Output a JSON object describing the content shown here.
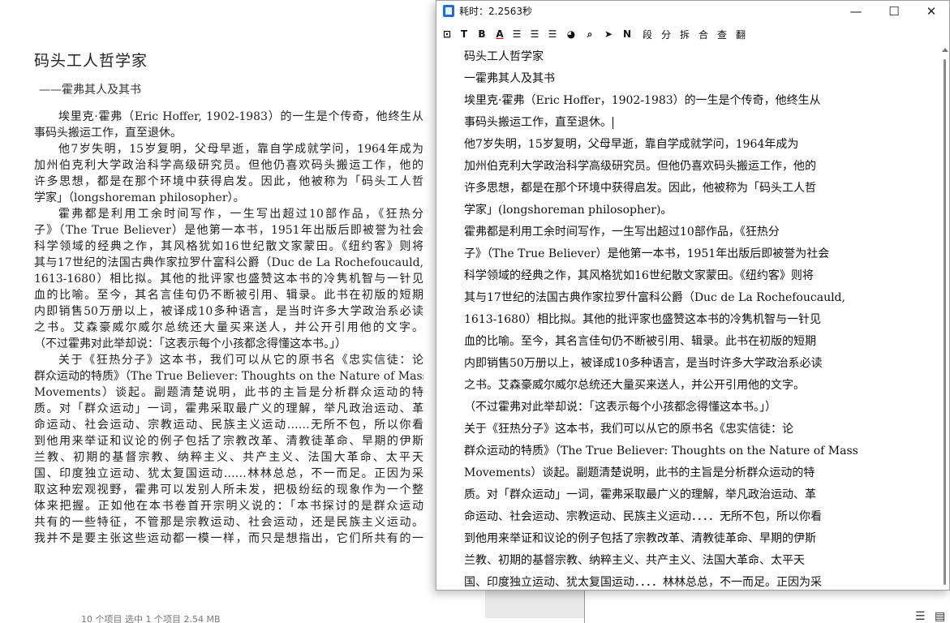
{
  "document": {
    "title": "码头工人哲学家",
    "subtitle": "——霍弗其人及其书",
    "lines": [
      "埃里克·霍弗（Eric Hoffer, 1902-1983）的一生是个传奇，他终生从",
      "事码头搬运工作，直至退休。",
      "他7岁失明，15岁复明，父母早逝，靠自学成就学问，1964年成为",
      "加州伯克利大学政治科学高级研究员。但他仍喜欢码头搬运工作，他的",
      "许多思想，都是在那个环境中获得启发。因此，他被称为「码头工人哲",
      "学家」（longshoreman philosopher）。",
      "霍弗都是利用工余时间写作，一生写出超过10部作品，《狂热分",
      "子》（The True Believer）是他第一本书，1951年出版后即被誉为社会",
      "科学领域的经典之作，其风格犹如16世纪散文家蒙田。《纽约客》则将",
      "其与17世纪的法国古典作家拉罗什富科公爵（Duc de La Rochefoucauld,",
      "1613-1680）相比拟。其他的批评家也盛赞这本书的冷隽机智与一针见",
      "血的比喻。至今，其名言佳句仍不断被引用、辑录。此书在初版的短期",
      "内即销售50万册以上，被译成10多种语言，是当时许多大学政治系必读",
      "之书。艾森豪威尔威尔总统还大量买来送人，并公开引用他的文字。",
      "（不过霍弗对此举却说：「这表示每个小孩都念得懂这本书。」）",
      "关于《狂热分子》这本书，我们可以从它的原书名《忠实信徒：论",
      "群众运动的特质》（The True Believer: Thoughts on the Nature of Mass",
      "Movements）谈起。副题清楚说明，此书的主旨是分析群众运动的特",
      "质。对「群众运动」一词，霍弗采取最广义的理解，举凡政治运动、革",
      "命运动、社会运动、宗教运动、民族主义运动……无所不包，所以你看",
      "到他用来举证和议论的例子包括了宗教改革、清教徒革命、早期的伊斯",
      "兰教、初期的基督宗教、纳粹主义、共产主义、法国大革命、太平天",
      "国、印度独立运动、犹太复国运动……林林总总，不一而足。正因为采",
      "取这种宏观视野，霍弗可以发别人所未发，把极纷纭的现象作为一个整",
      "体来把握。正如他在本书卷首开宗明义说的：「本书探讨的是群众运动",
      "共有的一些特征，不管那是宗教运动、社会运动，还是民族主义运动。",
      "我并不是要主张这些运动都一模一样，而只是想指出，它们所共有的一"
    ],
    "status_bar": "10 个项目    选中 1 个项目  2.54 MB"
  },
  "window": {
    "title": "耗时：2.2563秒",
    "minimize_symbol": "—",
    "maximize_symbol": "☐",
    "close_symbol": "✕"
  },
  "toolbar": {
    "items": [
      {
        "name": "frame-icon",
        "label": "⊡"
      },
      {
        "name": "text-icon",
        "label": "T"
      },
      {
        "name": "bold-icon",
        "label": "B"
      },
      {
        "name": "font-color-icon",
        "label": "A"
      },
      {
        "name": "align-left-icon",
        "label": "☰"
      },
      {
        "name": "align-justify-icon",
        "label": "☰"
      },
      {
        "name": "align-right-icon",
        "label": "☰"
      },
      {
        "name": "palette-icon",
        "label": "◕"
      },
      {
        "name": "search-icon",
        "label": "⌕"
      },
      {
        "name": "send-icon",
        "label": "➤"
      },
      {
        "name": "n-icon",
        "label": "N"
      },
      {
        "name": "segment-button",
        "label": "段"
      },
      {
        "name": "split-button",
        "label": "分"
      },
      {
        "name": "separate-button",
        "label": "拆"
      },
      {
        "name": "merge-button",
        "label": "合"
      },
      {
        "name": "lookup-button",
        "label": "查"
      },
      {
        "name": "translate-button",
        "label": "翻"
      }
    ]
  },
  "ocr_text": {
    "lines": [
      "码头工人哲学家",
      "一霍弗其人及其书",
      "埃里克·霍弗（Eric Hoffer，1902-1983）的一生是个传奇，他终生从",
      "事码头搬运工作，直至退休。",
      "他7岁失明，15岁复明，父母早逝，靠自学成就学问，1964年成为",
      "加州伯克利大学政治科学高级研究员。但他仍喜欢码头搬运工作，他的",
      "许多思想，都是在那个环境中获得启发。因此，他被称为「码头工人哲",
      "学家」(longshoreman philosopher)。",
      "霍弗都是利用工余时间写作，一生写出超过10部作品，《狂热分",
      "子》（The True Believer）是他第一本书，1951年出版后即被誉为社会",
      "科学领域的经典之作，其风格犹如16世纪散文家蒙田。《纽约客》则将",
      "其与17世纪的法国古典作家拉罗什富科公爵（Duc de La Rochefoucauld,",
      "1613-1680）相比拟。其他的批评家也盛赞这本书的冷隽机智与一针见",
      "血的比喻。至今，其名言佳句仍不断被引用、辑录。此书在初版的短期",
      "内即销售50万册以上，被译成10多种语言，是当时许多大学政治系必读",
      "之书。艾森豪威尔威尔总统还大量买来送人，并公开引用他的文字。",
      "（不过霍弗对此举却说：「这表示每个小孩都念得懂这本书。」）",
      "关于《狂热分子》这本书，我们可以从它的原书名《忠实信徒：论",
      "群众运动的特质》（The True Believer: Thoughts on the Nature of Mass",
      "Movements）谈起。副题清楚说明，此书的主旨是分析群众运动的特",
      "质。对「群众运动」一词，霍弗采取最广义的理解，举凡政治运动、革",
      "命运动、社会运动、宗教运动、民族主义运动．．．．无所不包，所以你看",
      "到他用来举证和议论的例子包括了宗教改革、清教徒革命、早期的伊斯",
      "兰教、初期的基督宗教、纳粹主义、共产主义、法国大革命、太平天",
      "国、印度独立运动、犹太复国运动．．．．林林总总，不一而足。正因为采"
    ]
  },
  "taskbar": {
    "icon_a": "☰",
    "icon_b": "▤"
  }
}
